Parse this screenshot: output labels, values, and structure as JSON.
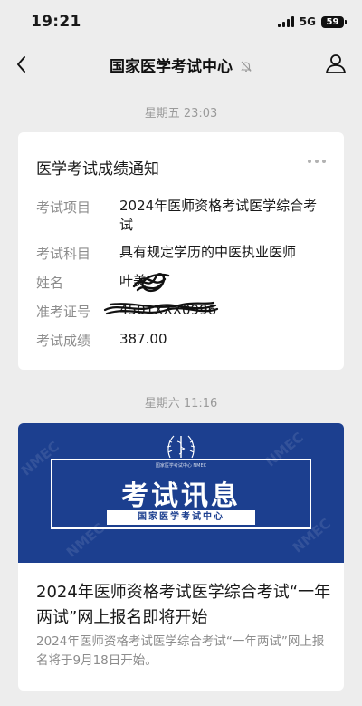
{
  "status_bar": {
    "time": "19:21",
    "network": "5G",
    "battery": "59"
  },
  "nav": {
    "title": "国家医学考试中心",
    "back_icon": "chevron-left-icon",
    "mute_icon": "bell-off-icon",
    "profile_icon": "person-icon"
  },
  "messages": [
    {
      "timestamp": "星期五 23:03",
      "card": {
        "title": "医学考试成绩通知",
        "fields": [
          {
            "label": "考试项目",
            "value": "2024年医师资格考试医学综合考试"
          },
          {
            "label": "考试科目",
            "value": "具有规定学历的中医执业医师"
          },
          {
            "label": "姓名",
            "value": "叶美"
          },
          {
            "label": "准考证号",
            "value": "4501ⅩⅩⅩ0996"
          },
          {
            "label": "考试成绩",
            "value": "387.00"
          }
        ]
      }
    },
    {
      "timestamp": "星期六 11:16",
      "article": {
        "banner_title": "考试讯息",
        "banner_subtitle": "国家医学考试中心",
        "banner_watermark": "NMEC",
        "emblem_text": "国家医学考试中心 NMEC",
        "title": "2024年医师资格考试医学综合考试“一年两试”网上报名即将开始",
        "summary": "2024年医师资格考试医学综合考试“一年两试”网上报名将于9月18日开始。"
      }
    }
  ],
  "colors": {
    "background": "#ededed",
    "banner_blue": "#1c3f8f",
    "card": "#ffffff",
    "muted_text": "#8c8c8c"
  }
}
